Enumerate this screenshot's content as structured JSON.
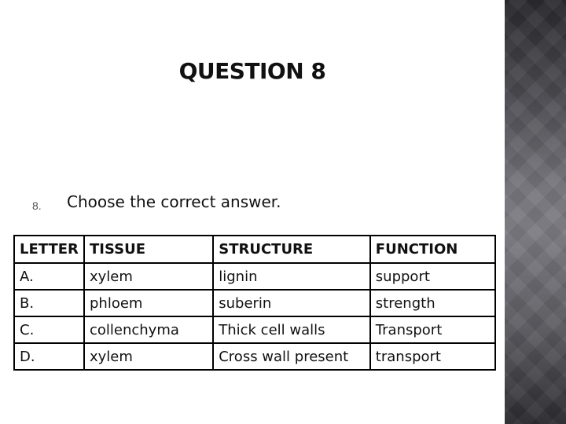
{
  "slide": {
    "title": "QUESTION 8",
    "question": {
      "number": "8.",
      "text": "Choose the correct answer."
    }
  },
  "table": {
    "headers": [
      "LETTER",
      "TISSUE",
      "STRUCTURE",
      "FUNCTION"
    ],
    "rows": [
      [
        "A.",
        "xylem",
        "lignin",
        "support"
      ],
      [
        "B.",
        "phloem",
        "suberin",
        "strength"
      ],
      [
        "C.",
        "collenchyma",
        "Thick cell walls",
        "Transport"
      ],
      [
        "D.",
        "xylem",
        "Cross wall present",
        "transport"
      ]
    ]
  }
}
